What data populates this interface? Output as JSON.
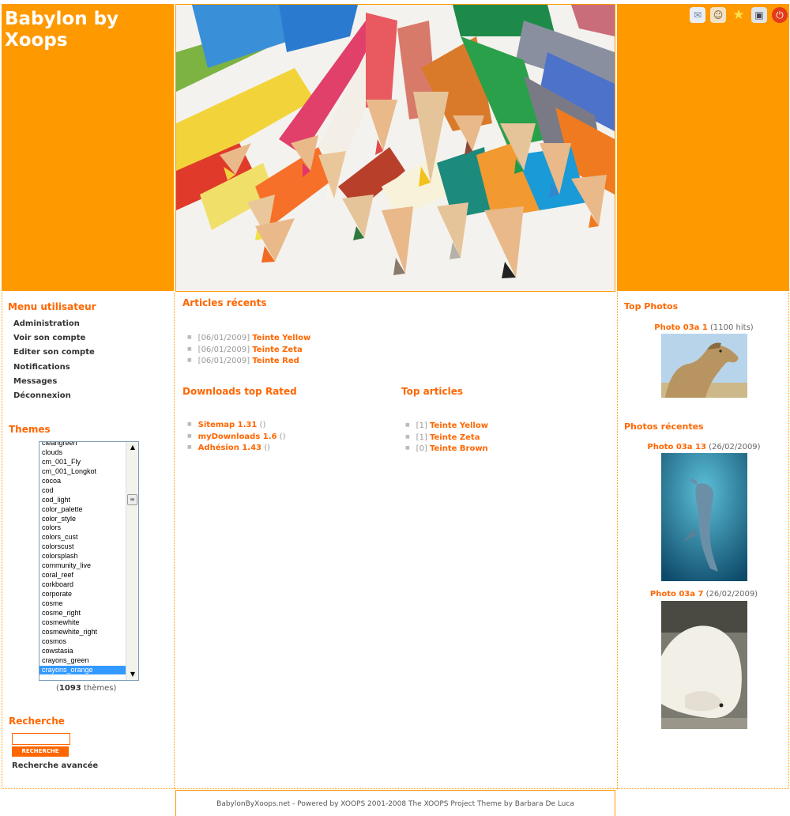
{
  "site": {
    "title": "Babylon by Xoops"
  },
  "header_icons": [
    "notifications-icon",
    "users-icon",
    "favorites-star-icon",
    "admin-icon",
    "logout-power-icon"
  ],
  "colors": {
    "brand_orange": "#ff9900",
    "link_orange": "#ff6600",
    "selected_option": "#3399ff"
  },
  "user_menu": {
    "title": "Menu utilisateur",
    "items": [
      "Administration",
      "Voir son compte",
      "Editer son compte",
      "Notifications",
      "Messages",
      "Déconnexion"
    ]
  },
  "themes": {
    "title": "Themes",
    "options": [
      "cleangreen",
      "clouds",
      "cm_001_Fly",
      "cm_001_Longkot",
      "cocoa",
      "cod",
      "cod_light",
      "color_palette",
      "color_style",
      "colors",
      "colors_cust",
      "colorscust",
      "colorsplash",
      "community_live",
      "coral_reef",
      "corkboard",
      "corporate",
      "cosme",
      "cosme_right",
      "cosmewhite",
      "cosmewhite_right",
      "cosmos",
      "cowstasia",
      "crayons_green",
      "crayons_orange"
    ],
    "selected": "crayons_orange",
    "count_prefix": "(",
    "count": "1093",
    "count_suffix": " thèmes)"
  },
  "search": {
    "title": "Recherche",
    "button": "RECHERCHE",
    "advanced": "Recherche avancée",
    "value": ""
  },
  "recent_articles": {
    "title": "Articles récents",
    "items": [
      {
        "date": "[06/01/2009]",
        "title": "Teinte Yellow"
      },
      {
        "date": "[06/01/2009]",
        "title": "Teinte Zeta"
      },
      {
        "date": "[06/01/2009]",
        "title": "Teinte Red"
      }
    ]
  },
  "downloads_top": {
    "title": "Downloads top Rated",
    "items": [
      {
        "title": "Sitemap 1.31",
        "count": "()"
      },
      {
        "title": "myDownloads 1.6",
        "count": "()"
      },
      {
        "title": "Adhésion 1.43",
        "count": "()"
      }
    ]
  },
  "top_articles": {
    "title": "Top articles",
    "items": [
      {
        "count": "[1]",
        "title": "Teinte Yellow"
      },
      {
        "count": "[1]",
        "title": "Teinte Zeta"
      },
      {
        "count": "[0]",
        "title": "Teinte Brown"
      }
    ]
  },
  "top_photos": {
    "title": "Top Photos",
    "items": [
      {
        "title": "Photo 03a 1",
        "meta": "(1100 hits)"
      }
    ]
  },
  "recent_photos": {
    "title": "Photos récentes",
    "items": [
      {
        "title": "Photo 03a 13",
        "meta": "(26/02/2009)"
      },
      {
        "title": "Photo 03a 7",
        "meta": "(26/02/2009)"
      }
    ]
  },
  "footer": {
    "text": "BabylonByXoops.net - Powered by XOOPS 2001-2008 The XOOPS Project Theme by Barbara De Luca"
  }
}
